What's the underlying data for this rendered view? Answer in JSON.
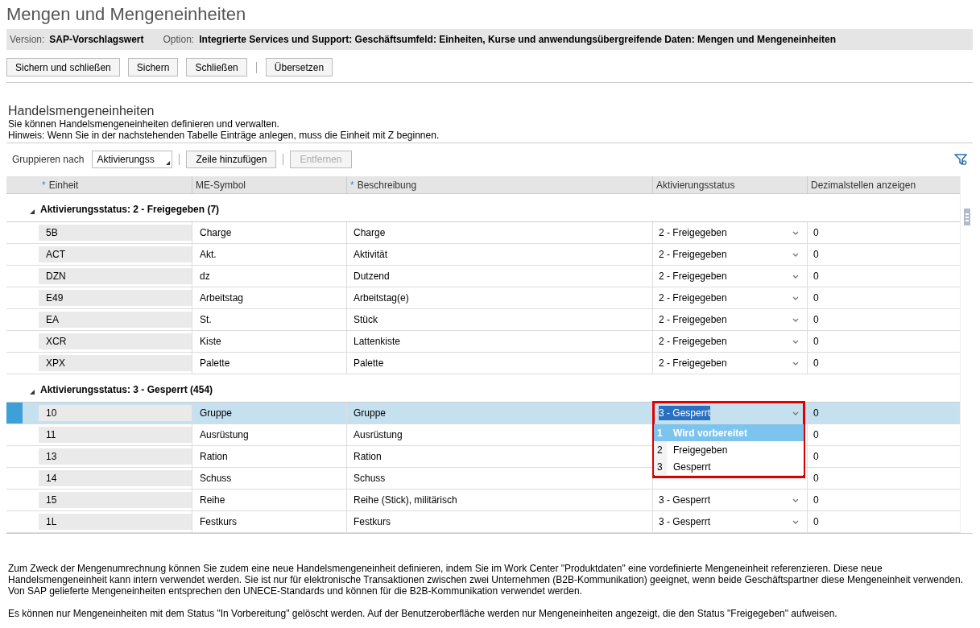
{
  "title": "Mengen und Mengeneinheiten",
  "info_bar": [
    {
      "label": "Version:",
      "value": "SAP-Vorschlagswert"
    },
    {
      "label": "Option:",
      "value": "Integrierte Services und Support: Geschäftsumfeld: Einheiten, Kurse und anwendungsübergreifende Daten: Mengen und Mengeneinheiten"
    }
  ],
  "toolbar": [
    {
      "label": "Sichern und schließen",
      "separator_before": false
    },
    {
      "label": "Sichern",
      "separator_before": false
    },
    {
      "label": "Schließen",
      "separator_before": false
    },
    {
      "label": "Übersetzen",
      "separator_before": true
    }
  ],
  "section": {
    "title": "Handelsmengeneinheiten",
    "description": [
      "Sie können Handelsmengeneinheiten definieren und verwalten.",
      "Hinweis: Wenn Sie in der nachstehenden Tabelle Einträge anlegen, muss die Einheit mit Z beginnen."
    ]
  },
  "table_toolbar": {
    "group_label": "Gruppieren nach",
    "group_value": "Aktivierungss",
    "buttons": [
      {
        "label": "Zeile hinzufügen",
        "disabled": false
      },
      {
        "label": "Entfernen",
        "disabled": true
      }
    ]
  },
  "table": {
    "columns": [
      {
        "label": "Einheit",
        "required_mark": "*"
      },
      {
        "label": "ME-Symbol"
      },
      {
        "label": "Beschreibung",
        "required_mark": "*"
      },
      {
        "label": "Aktivierungsstatus"
      },
      {
        "label": "Dezimalstellen anzeigen"
      }
    ],
    "groups": [
      {
        "label": "Aktivierungsstatus: 2 - Freigegeben (7)",
        "expanded": true,
        "rows": [
          {
            "unit": "5B",
            "symbol": "Charge",
            "description": "Charge",
            "status": "2 - Freigegeben",
            "decimals": "0",
            "selected": false
          },
          {
            "unit": "ACT",
            "symbol": "Akt.",
            "description": "Aktivität",
            "status": "2 - Freigegeben",
            "decimals": "0",
            "selected": false
          },
          {
            "unit": "DZN",
            "symbol": "dz",
            "description": "Dutzend",
            "status": "2 - Freigegeben",
            "decimals": "0",
            "selected": false
          },
          {
            "unit": "E49",
            "symbol": "Arbeitstag",
            "description": "Arbeitstag(e)",
            "status": "2 - Freigegeben",
            "decimals": "0",
            "selected": false
          },
          {
            "unit": "EA",
            "symbol": "St.",
            "description": "Stück",
            "status": "2 - Freigegeben",
            "decimals": "0",
            "selected": false
          },
          {
            "unit": "XCR",
            "symbol": "Kiste",
            "description": "Lattenkiste",
            "status": "2 - Freigegeben",
            "decimals": "0",
            "selected": false
          },
          {
            "unit": "XPX",
            "symbol": "Palette",
            "description": "Palette",
            "status": "2 - Freigegeben",
            "decimals": "0",
            "selected": false
          }
        ]
      },
      {
        "label": "Aktivierungsstatus: 3 - Gesperrt (454)",
        "expanded": true,
        "rows": [
          {
            "unit": "10",
            "symbol": "Gruppe",
            "description": "Gruppe",
            "status": "3 - Gesperrt",
            "decimals": "0",
            "selected": true
          },
          {
            "unit": "11",
            "symbol": "Ausrüstung",
            "description": "Ausrüstung",
            "decimals": "0",
            "selected": false
          },
          {
            "unit": "13",
            "symbol": "Ration",
            "description": "Ration",
            "decimals": "0",
            "selected": false
          },
          {
            "unit": "14",
            "symbol": "Schuss",
            "description": "Schuss",
            "decimals": "0",
            "selected": false
          },
          {
            "unit": "15",
            "symbol": "Reihe",
            "description": "Reihe (Stick), militärisch",
            "status": "3 - Gesperrt",
            "decimals": "0",
            "selected": false
          },
          {
            "unit": "1L",
            "symbol": "Festkurs",
            "description": "Festkurs",
            "status": "3 - Gesperrt",
            "decimals": "0",
            "selected": false
          }
        ]
      }
    ]
  },
  "dropdown": {
    "options": [
      {
        "number": "1",
        "label": "Wird vorbereitet",
        "selected": true
      },
      {
        "number": "2",
        "label": "Freigegeben",
        "selected": false
      },
      {
        "number": "3",
        "label": "Gesperrt",
        "selected": false
      }
    ]
  },
  "footer": [
    [
      "Zum Zweck der Mengenumrechnung können Sie zudem eine neue Handelsmengeneinheit definieren, indem Sie im Work Center \"Produktdaten\" eine vordefinierte Mengeneinheit referenzieren. Diese neue Handelsmengeneinheit kann intern verwendet werden. Sie ist nur für elektronische Transaktionen zwischen zwei Unternehmen (B2B-Kommunikation) geeignet, wenn beide Geschäftspartner diese Mengeneinheit verwenden.",
      "Von SAP gelieferte Mengeneinheiten entsprechen den UNECE-Standards und können für die B2B-Kommunikation verwendet werden."
    ],
    [
      "Es können nur Mengeneinheiten mit dem Status \"In Vorbereitung\" gelöscht werden. Auf der Benutzeroberfläche werden nur Mengeneinheiten angezeigt, die den Status \"Freigegeben\" aufweisen."
    ]
  ]
}
